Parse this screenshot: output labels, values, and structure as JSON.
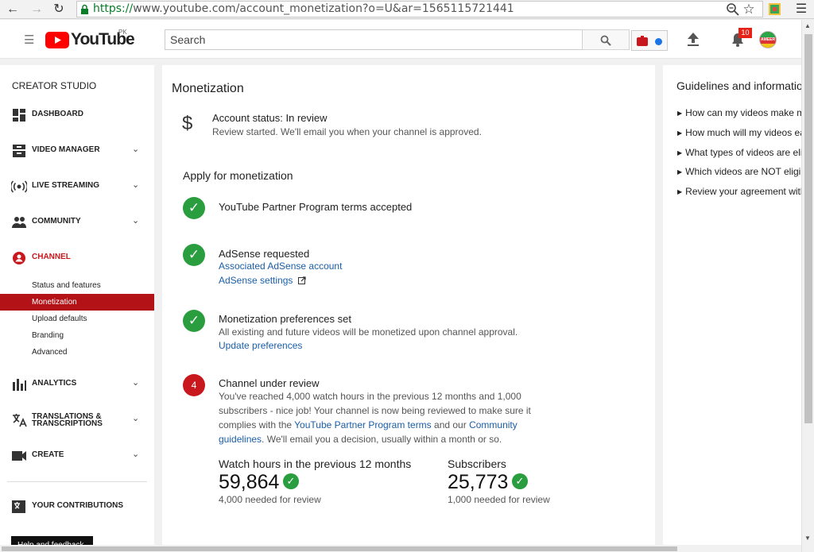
{
  "browser": {
    "url_scheme": "https://",
    "url_rest": "www.youtube.com/account_monetization?o=U&ar=1565115721441"
  },
  "header": {
    "logo_text": "YouTube",
    "logo_region": "PK",
    "search_placeholder": "Search",
    "notification_count": "10",
    "avatar_text": "AMEER"
  },
  "sidebar": {
    "title": "CREATOR STUDIO",
    "items": {
      "dashboard": "DASHBOARD",
      "video_manager": "VIDEO MANAGER",
      "live_streaming": "LIVE STREAMING",
      "community": "COMMUNITY",
      "channel": "CHANNEL",
      "analytics": "ANALYTICS",
      "translations_1": "TRANSLATIONS &",
      "translations_2": "TRANSCRIPTIONS",
      "create": "CREATE",
      "contributions": "YOUR CONTRIBUTIONS"
    },
    "channel_sub": [
      "Status and features",
      "Monetization",
      "Upload defaults",
      "Branding",
      "Advanced"
    ],
    "help_feedback": "Help and feedback"
  },
  "main": {
    "title": "Monetization",
    "account_status_label": "Account status: In review",
    "account_status_desc": "Review started. We'll email you when your channel is approved.",
    "apply_heading": "Apply for monetization",
    "step1_title": "YouTube Partner Program terms accepted",
    "step2_title": "AdSense requested",
    "step2_link1": "Associated AdSense account",
    "step2_link2": "AdSense settings",
    "step3_title": "Monetization preferences set",
    "step3_desc": "All existing and future videos will be monetized upon channel approval.",
    "step3_link": "Update preferences",
    "step4_num": "4",
    "step4_title": "Channel under review",
    "step4_line1": "You've reached 4,000 watch hours in the previous 12 months and 1,000",
    "step4_line2": "subscribers - nice job! Your channel is now being reviewed to make sure it",
    "step4_line3_a": "complies with the ",
    "step4_line3_link1": "YouTube Partner Program terms",
    "step4_line3_b": " and our ",
    "step4_line3_link2": "Community",
    "step4_line4_link": "guidelines",
    "step4_line4_b": ". We'll email you a decision, usually within a month or so.",
    "watch_label": "Watch hours in the previous 12 months",
    "watch_value": "59,864",
    "watch_needed": "4,000 needed for review",
    "subs_label": "Subscribers",
    "subs_value": "25,773",
    "subs_needed": "1,000 needed for review"
  },
  "guidelines": {
    "title": "Guidelines and information",
    "items": [
      "How can my videos make money?",
      "How much will my videos earn?",
      "What types of videos are eligible?",
      "Which videos are NOT eligible?",
      "Review your agreement with YouTube"
    ]
  },
  "colors": {
    "brand_red": "#ff0000",
    "active_red": "#b31217",
    "check_green": "#2a9d3f",
    "link_blue": "#1a5ea8"
  }
}
